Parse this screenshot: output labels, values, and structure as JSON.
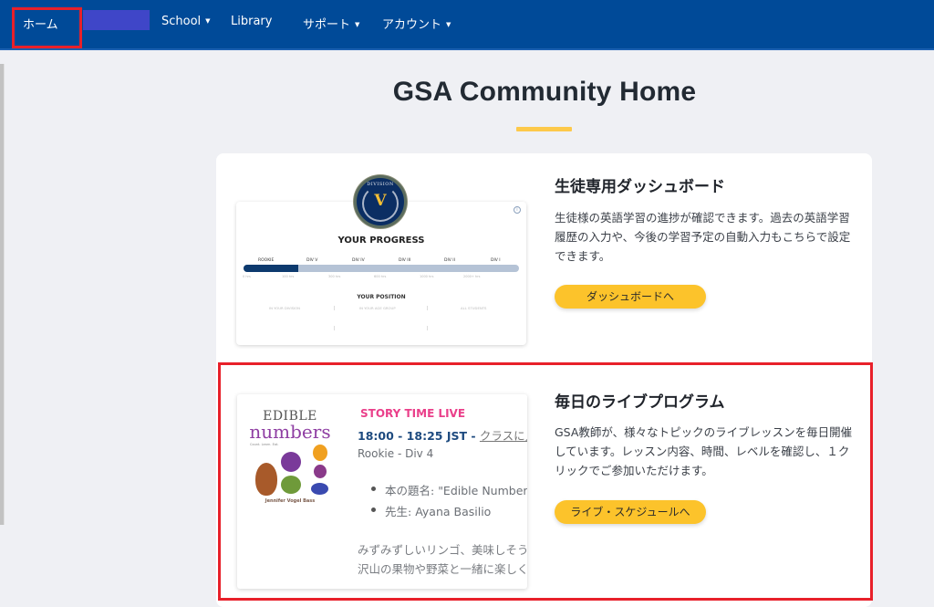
{
  "nav": {
    "items": [
      {
        "label": "ホーム",
        "has_dropdown": false
      },
      {
        "label": "School",
        "has_dropdown": true
      },
      {
        "label": "Library",
        "has_dropdown": false
      },
      {
        "label": "サポート",
        "has_dropdown": true
      },
      {
        "label": "アカウント",
        "has_dropdown": true
      }
    ],
    "dropdown_caret": "▼"
  },
  "page": {
    "title": "GSA Community Home",
    "accent_color": "#fdc94a",
    "nav_color": "#004a98",
    "highlight_color": "#e8202a"
  },
  "sections": [
    {
      "heading": "生徒専用ダッシュボード",
      "description": "生徒様の英語学習の進捗が確認できます。過去の英語学習履歴の入力や、今後の学習予定の自動入力もこちらで設定できます。",
      "button": "ダッシュボードへ",
      "preview": {
        "badge_label": "DIVISION",
        "badge_level": "V",
        "title": "YOUR PROGRESS",
        "divisions": [
          "ROOKIE",
          "DIV V",
          "DIV IV",
          "DIV III",
          "DIV II",
          "DIV I"
        ],
        "hours": [
          "0 hrs",
          "100 hrs",
          "300 hrs",
          "600 hrs",
          "1000 hrs",
          "2000+ hrs"
        ],
        "progress_fraction": 0.2,
        "position_title": "YOUR POSITION",
        "position_columns": [
          "IN YOUR DIVISION",
          "IN YOUR AGE GROUP",
          "ALL STUDENTS"
        ]
      }
    },
    {
      "heading": "毎日のライブプログラム",
      "description": "GSA教師が、様々なトピックのライブレッスンを毎日開催しています。レッスン内容、時間、レベルを確認し、１クリックでご参加いただけます。",
      "button": "ライブ・スケジュールへ",
      "preview": {
        "book_title_1": "EDIBLE",
        "book_title_2": "numbers",
        "book_subtitle": "Count. Learn. Eat.",
        "book_author": "Jennifer Vogel Bass",
        "program": "STORY TIME LIVE",
        "time": "18:00 - 18:25 JST - ",
        "join_link": "クラスに入る",
        "level": "Rookie - Div 4",
        "book_name_label": "本の題名: ",
        "book_name_value": "\"Edible Numbers\"",
        "teacher_label": "先生: ",
        "teacher_value": "Ayana Basilio",
        "summary_line1": "みずみずしいリンゴ、美味しそうな",
        "summary_line2": "沢山の果物や野菜と一緒に楽しく"
      }
    }
  ]
}
